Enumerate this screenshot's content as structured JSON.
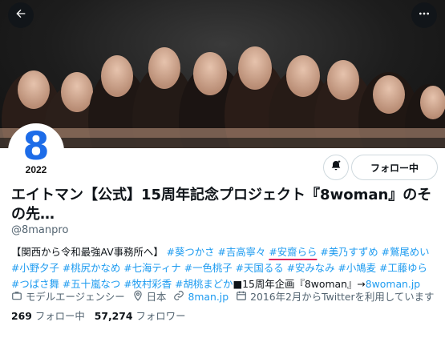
{
  "header": {
    "back_icon": "arrow-left-icon",
    "more_icon": "more-horizontal-icon"
  },
  "avatar": {
    "number": "8",
    "year": "2022"
  },
  "actions": {
    "notify_icon": "bell-plus-icon",
    "follow_label": "フォロー中"
  },
  "profile": {
    "display_name": "エイトマン【公式】15周年記念プロジェクト『8woman』のその先…",
    "handle": "@8manpro"
  },
  "bio": {
    "intro": "【関西から令和最強AV事務所へ】",
    "tag1": "#葵つかさ",
    "tag2": "#吉高寧々",
    "tag3": "#安齋らら",
    "tag4": "#美乃すずめ",
    "tag5": "#鷲尾めい",
    "tag6": "#小野夕子",
    "tag7": "#桃尻かなめ",
    "tag8": "#七海ティナ",
    "tag9": "#一色桃子",
    "tag10": "#天国るる",
    "tag11": "#安みなみ",
    "tag12": "#小鳩麦",
    "tag13": "#工藤ゆら",
    "tag14": "#つばさ舞",
    "tag15": "#五十嵐なつ",
    "tag16": "#牧村彩香",
    "tag17": "#胡桃まどか",
    "outro": "■15周年企画『8woman』→",
    "link": "8woman.jp"
  },
  "meta": {
    "category": "モデルエージェンシー",
    "location": "日本",
    "website": "8man.jp",
    "joined": "2016年2月からTwitterを利用しています"
  },
  "stats": {
    "following_count": "269",
    "following_label": "フォロー中",
    "followers_count": "57,274",
    "followers_label": "フォロワー"
  },
  "colors": {
    "accent": "#1d9bf0",
    "avatar_blue": "#1d6ce8",
    "underline": "#e0245e"
  }
}
